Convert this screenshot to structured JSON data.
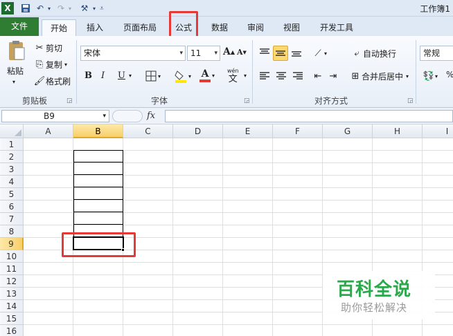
{
  "window": {
    "title": "工作簿1"
  },
  "quick_access": {
    "save_icon": "save-icon",
    "undo_icon": "undo-icon",
    "redo_icon": "redo-icon"
  },
  "tabs": [
    "文件",
    "开始",
    "插入",
    "页面布局",
    "公式",
    "数据",
    "审阅",
    "视图",
    "开发工具"
  ],
  "ribbon": {
    "clipboard": {
      "label": "剪贴板",
      "paste": "粘贴",
      "cut": "剪切",
      "copy": "复制",
      "format_painter": "格式刷"
    },
    "font": {
      "label": "字体",
      "font_name": "宋体",
      "font_size": "11",
      "bold": "B",
      "italic": "I",
      "underline": "U",
      "grow": "A",
      "shrink": "A",
      "color_a": "A",
      "phonetic": "wén"
    },
    "alignment": {
      "label": "对齐方式",
      "wrap_text": "自动换行",
      "merge_center": "合并后居中"
    },
    "number": {
      "format": "常规",
      "percent": "%"
    }
  },
  "formula_bar": {
    "name_box": "B9",
    "fx": "fx",
    "value": ""
  },
  "grid": {
    "columns": [
      "A",
      "B",
      "C",
      "D",
      "E",
      "F",
      "G",
      "H",
      "I"
    ],
    "rows": [
      "1",
      "2",
      "3",
      "4",
      "5",
      "6",
      "7",
      "8",
      "9",
      "10",
      "11",
      "12",
      "13",
      "14",
      "15",
      "16"
    ],
    "selected_column": "B",
    "selected_row": "9",
    "active_cell": "B9"
  },
  "watermark": {
    "title": "百科全说",
    "subtitle": "助你轻松解决"
  },
  "colors": {
    "file_tab": "#2e7d32",
    "highlight_box": "#e53935",
    "selected_header": "#f7cf6a",
    "watermark_green": "#2aa84a"
  }
}
